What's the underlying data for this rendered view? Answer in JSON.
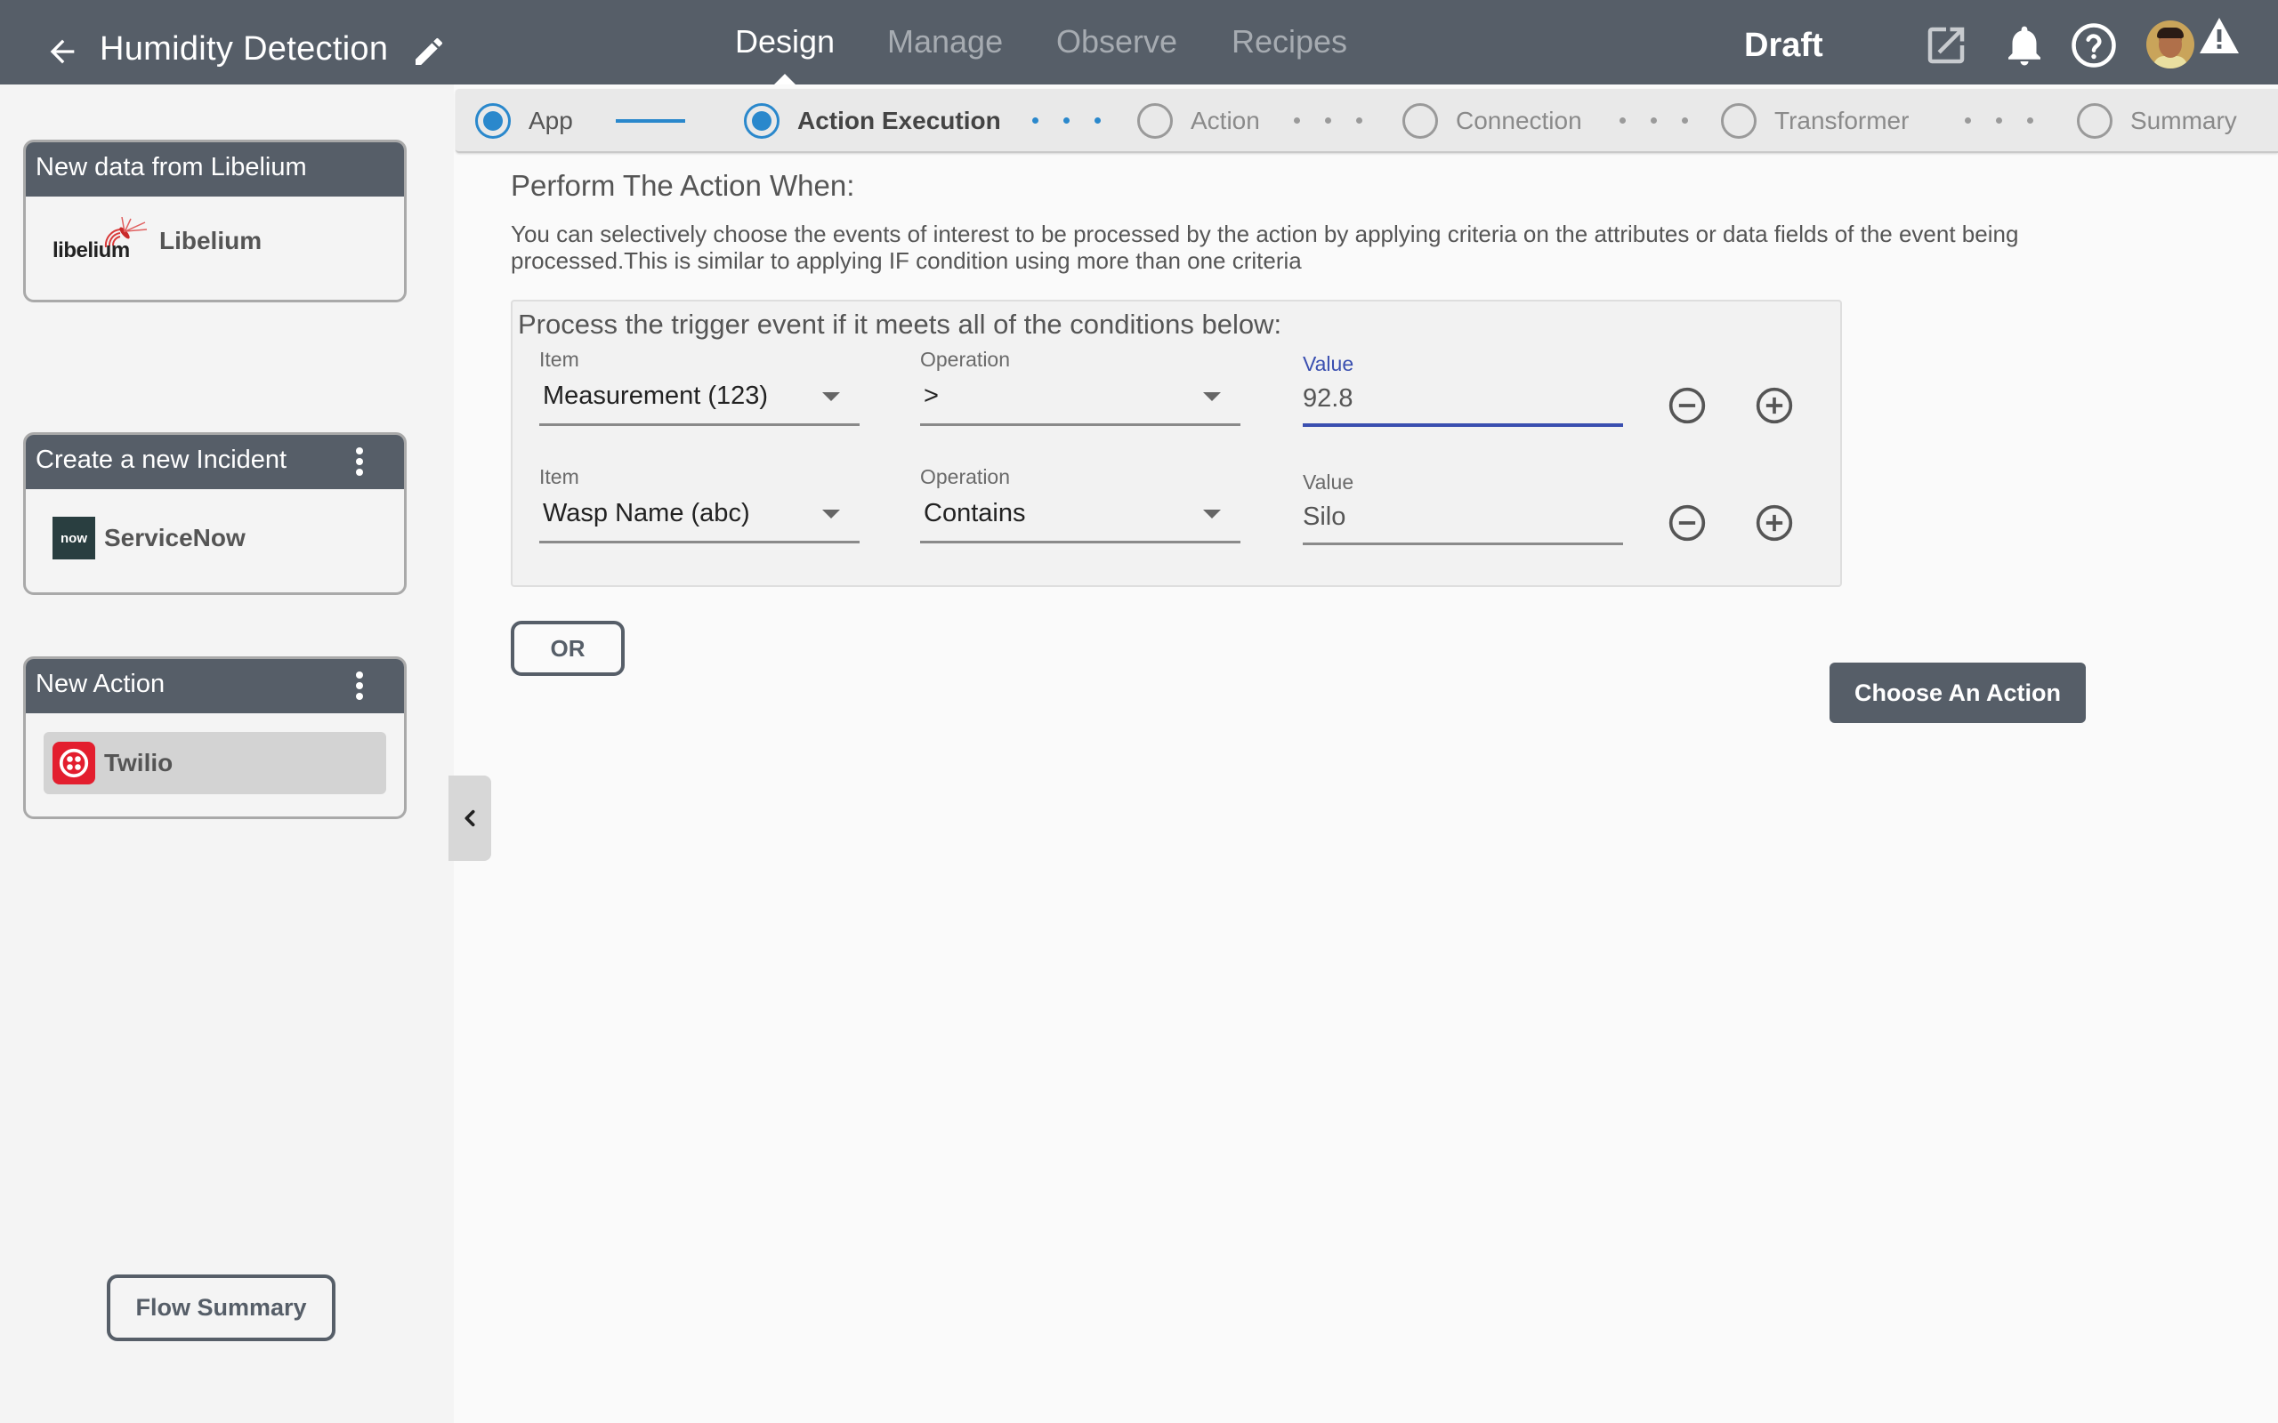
{
  "header": {
    "title": "Humidity Detection",
    "nav_tabs": [
      {
        "label": "Design",
        "active": true
      },
      {
        "label": "Manage",
        "active": false
      },
      {
        "label": "Observe",
        "active": false
      },
      {
        "label": "Recipes",
        "active": false
      }
    ],
    "status": "Draft",
    "icons": [
      "back-arrow-icon",
      "pencil-icon",
      "open-external-icon",
      "bell-icon",
      "help-icon",
      "avatar",
      "warning-icon"
    ]
  },
  "stepper": {
    "steps": [
      {
        "label": "App",
        "state": "done"
      },
      {
        "label": "Action Execution",
        "state": "current"
      },
      {
        "label": "Action",
        "state": "pending"
      },
      {
        "label": "Connection",
        "state": "pending"
      },
      {
        "label": "Transformer",
        "state": "pending"
      },
      {
        "label": "Summary",
        "state": "pending"
      }
    ]
  },
  "sidebar": {
    "cards": [
      {
        "title": "New data from Libelium",
        "app": "Libelium",
        "logo_text": "libelium",
        "has_menu": false,
        "selected": false
      },
      {
        "title": "Create a new Incident",
        "app": "ServiceNow",
        "logo_text": "now",
        "has_menu": true,
        "selected": false
      },
      {
        "title": "New Action",
        "app": "Twilio",
        "logo_text": "",
        "has_menu": true,
        "selected": true
      }
    ],
    "flow_summary_label": "Flow Summary"
  },
  "main": {
    "title": "Perform The Action When:",
    "description": "You can selectively choose the events of interest to be processed by the action by applying criteria on the attributes or data fields of the event being processed.This is similar to applying IF condition using more than one criteria",
    "conditions_heading": "Process the trigger event if it meets all of the conditions below:",
    "conditions": [
      {
        "item_label": "Item",
        "item": "Measurement (123)",
        "operation_label": "Operation",
        "operation": ">",
        "value_label": "Value",
        "value": "92.8",
        "focused": true
      },
      {
        "item_label": "Item",
        "item": "Wasp Name (abc)",
        "operation_label": "Operation",
        "operation": "Contains",
        "value_label": "Value",
        "value": "Silo",
        "focused": false
      }
    ],
    "or_label": "OR",
    "choose_action_label": "Choose An Action"
  },
  "colors": {
    "header_bg": "#565e68",
    "accent_blue": "#2a88cc",
    "focus_indigo": "#3a4fb0",
    "twilio_red": "#e31e2e",
    "servicenow_bg": "#293e40"
  }
}
